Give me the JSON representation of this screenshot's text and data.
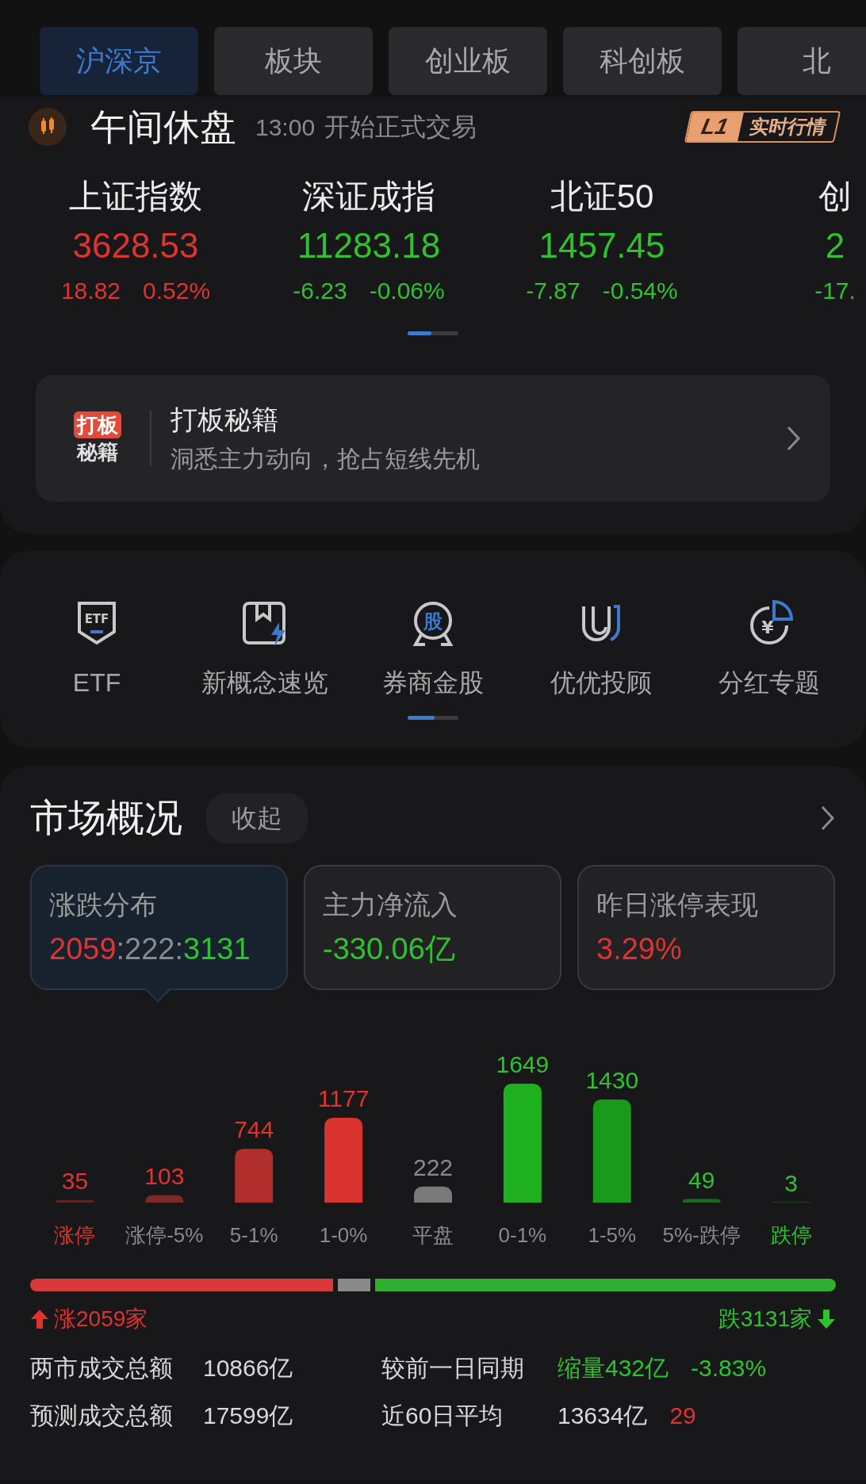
{
  "tabs": [
    {
      "label": "沪深京",
      "selected": true
    },
    {
      "label": "板块",
      "selected": false
    },
    {
      "label": "创业板",
      "selected": false
    },
    {
      "label": "科创板",
      "selected": false
    },
    {
      "label": "北",
      "selected": false
    }
  ],
  "session": {
    "title": "午间休盘",
    "time": "13:00",
    "note": "开始正式交易",
    "badge_level": "L1",
    "badge_text": "实时行情"
  },
  "indices": [
    {
      "name": "上证指数",
      "value": "3628.53",
      "change": "18.82",
      "percent": "0.52%",
      "color": "#e0332f"
    },
    {
      "name": "深证成指",
      "value": "11283.18",
      "change": "-6.23",
      "percent": "-0.06%",
      "color": "#2fc22f"
    },
    {
      "name": "北证50",
      "value": "1457.45",
      "change": "-7.87",
      "percent": "-0.54%",
      "color": "#2fc22f"
    },
    {
      "name": "创",
      "value": "2",
      "change": "-17.",
      "color": "#2fc22f"
    }
  ],
  "promo": {
    "logo_top": "打板",
    "logo_bottom": "秘籍",
    "title": "打板秘籍",
    "subtitle": "洞悉主力动向，抢占短线先机"
  },
  "shortcuts": [
    {
      "label": "ETF",
      "kind": "etf",
      "icon_text": "ETF"
    },
    {
      "label": "新概念速览",
      "kind": "bookmark"
    },
    {
      "label": "券商金股",
      "kind": "medal",
      "icon_text": "股"
    },
    {
      "label": "优优投顾",
      "kind": "uu"
    },
    {
      "label": "分红专题",
      "kind": "dividend",
      "icon_text": "¥"
    }
  ],
  "market": {
    "title": "市场概况",
    "collapse": "收起",
    "cards": [
      {
        "label": "涨跌分布",
        "selected": true,
        "parts": [
          {
            "text": "2059",
            "color": "#e0332f"
          },
          {
            "text": ":222:",
            "color": "#8a8a8a"
          },
          {
            "text": "3131",
            "color": "#2fc22f"
          }
        ]
      },
      {
        "label": "主力净流入",
        "selected": false,
        "parts": [
          {
            "text": "-330.06亿",
            "color": "#2fc22f"
          }
        ]
      },
      {
        "label": "昨日涨停表现",
        "selected": false,
        "parts": [
          {
            "text": "3.29%",
            "color": "#e0332f"
          }
        ]
      }
    ],
    "bar_styles": [
      {
        "kind": "limit_up",
        "color": "#5e2424"
      },
      {
        "kind": "up",
        "color": "#7a2a28"
      },
      {
        "kind": "up",
        "color": "#b02f2d"
      },
      {
        "kind": "up",
        "color": "#d8332f"
      },
      {
        "kind": "flat",
        "color": "#7a7a7a"
      },
      {
        "kind": "down",
        "color": "#1fb01f"
      },
      {
        "kind": "down",
        "color": "#1a9a1a"
      },
      {
        "kind": "down",
        "color": "#1f6a1f"
      },
      {
        "kind": "limit_down"
      }
    ],
    "chart_data": {
      "type": "bar",
      "categories": [
        "涨停",
        "涨停-5%",
        "5-1%",
        "1-0%",
        "平盘",
        "0-1%",
        "1-5%",
        "5%-跌停",
        "跌停"
      ],
      "values": [
        35,
        103,
        744,
        1177,
        222,
        1649,
        1430,
        49,
        3
      ],
      "value_labels": [
        "35",
        "103",
        "744",
        "1177",
        "222",
        "1649",
        "1430",
        "49",
        "3"
      ]
    },
    "up_count": "涨2059家",
    "down_count": "跌3131家",
    "stats": [
      {
        "label": "两市成交总额",
        "value": "10866亿",
        "compare_label": "较前一日同期",
        "parts": [
          {
            "text": "缩量432亿",
            "color": "#2fc22f"
          },
          {
            "text": "-3.83%",
            "color": "#2fc22f"
          }
        ]
      },
      {
        "label": "预测成交总额",
        "value": "17599亿",
        "compare_label": "近60日平均",
        "parts": [
          {
            "text": "13634亿",
            "color": "#d8d8d8"
          },
          {
            "text": "29",
            "color": "#e0332f"
          }
        ]
      }
    ]
  }
}
